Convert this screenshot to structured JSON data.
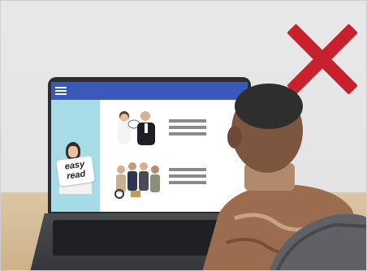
{
  "scene": {
    "description_tags": [
      "laptop",
      "person",
      "red-cross"
    ],
    "colors": {
      "wall": "#e6e6e6",
      "desk": "#d4bc96",
      "red_x": "#c8202c",
      "screen_header": "#3b59b9",
      "screen_side_panel": "#a8dbe8"
    }
  },
  "screen": {
    "sign_line1": "easy",
    "sign_line2": "read"
  }
}
